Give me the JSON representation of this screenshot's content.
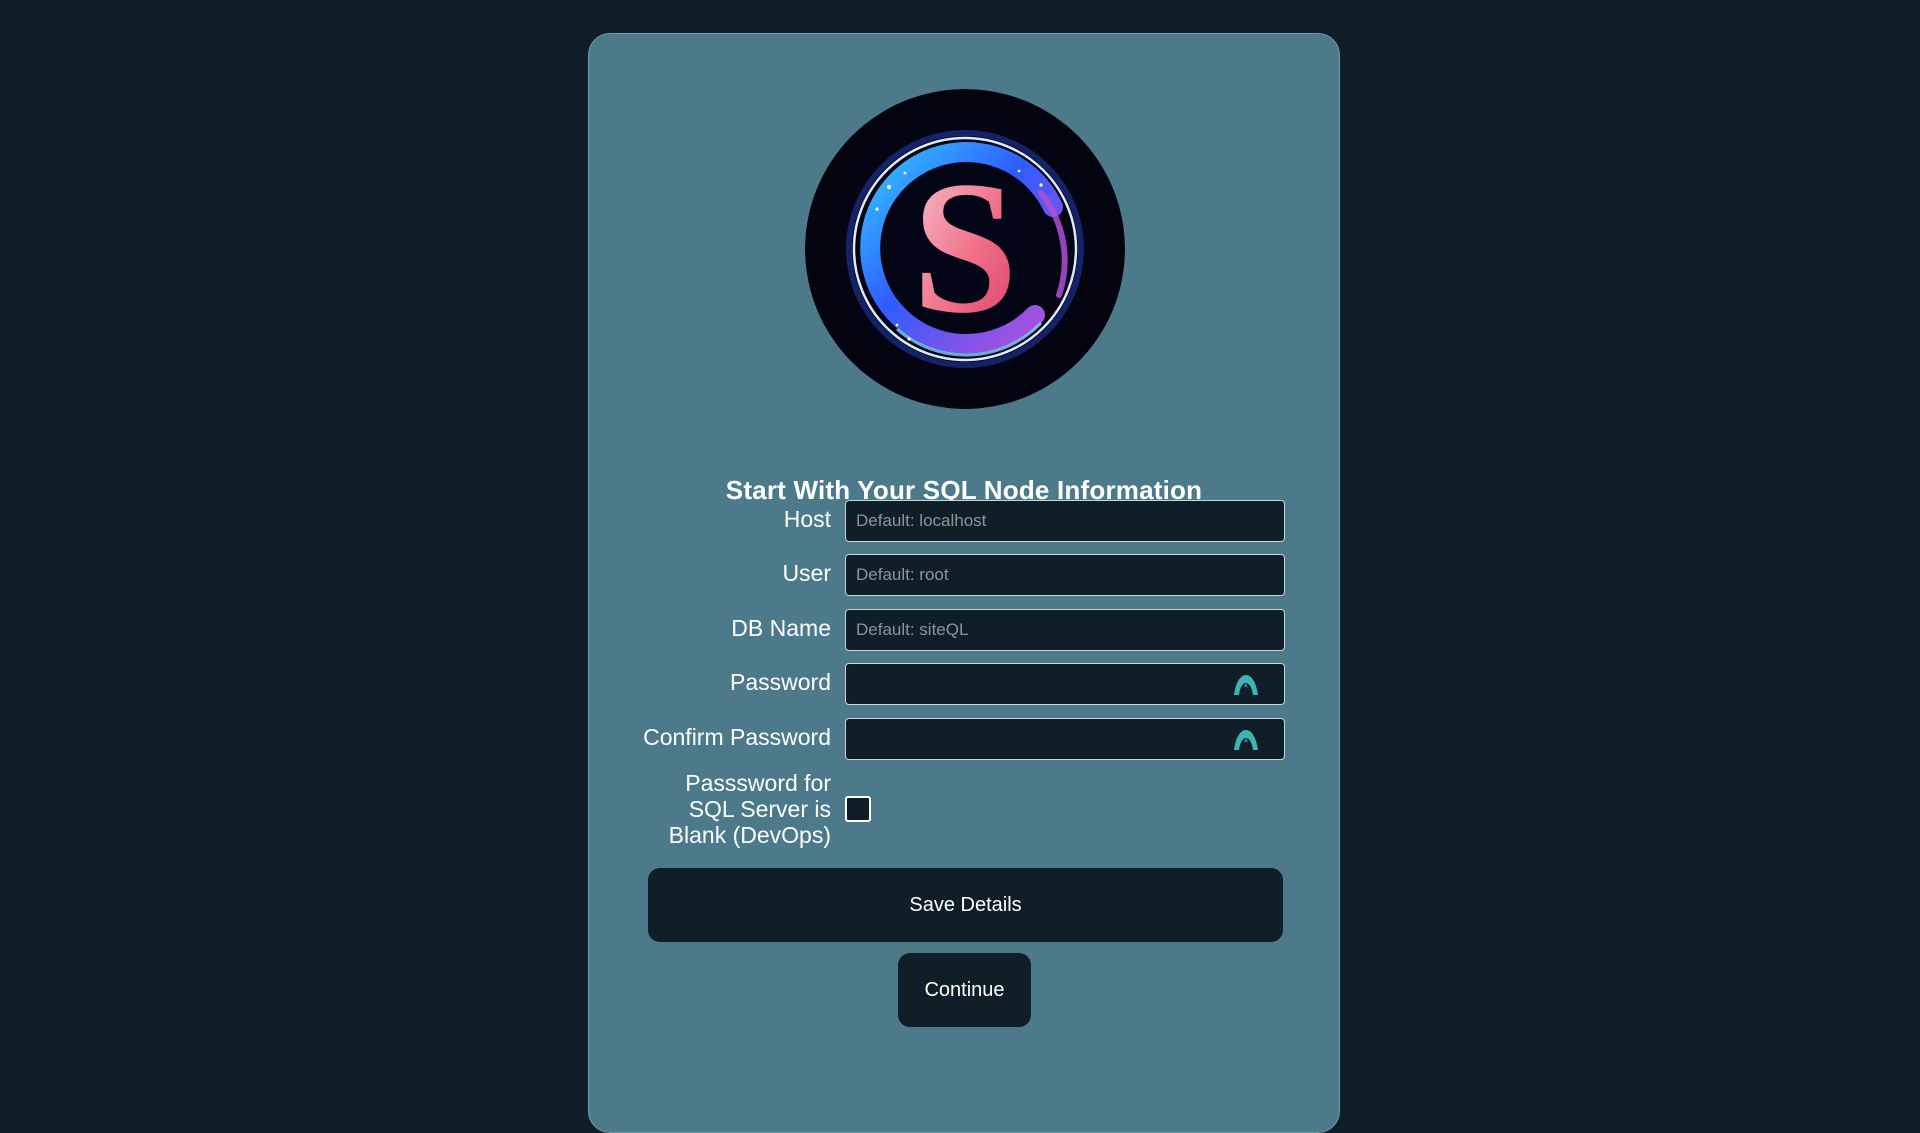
{
  "form": {
    "title": "Start With Your SQL Node Information",
    "logo_letter": "S",
    "fields": {
      "host": {
        "label": "Host",
        "placeholder": "Default: localhost",
        "value": ""
      },
      "user": {
        "label": "User",
        "placeholder": "Default: root",
        "value": ""
      },
      "db_name": {
        "label": "DB Name",
        "placeholder": "Default: siteQL",
        "value": ""
      },
      "password": {
        "label": "Password",
        "placeholder": "",
        "value": "",
        "toggle_icon": "eye-icon"
      },
      "confirm_password": {
        "label": "Confirm Password",
        "placeholder": "",
        "value": "",
        "toggle_icon": "eye-icon"
      }
    },
    "blank_password": {
      "label_line1": "Passsword for",
      "label_line2": "SQL Server is",
      "label_line3": "Blank (DevOps)",
      "checked": false
    },
    "buttons": {
      "save_label": "Save Details",
      "continue_label": "Continue"
    }
  },
  "colors": {
    "page_background": "#101f27",
    "card_background": "#4c7a8b",
    "input_background": "#101f27",
    "eye_icon": "#3fb3b3",
    "text": "#ffffff"
  }
}
